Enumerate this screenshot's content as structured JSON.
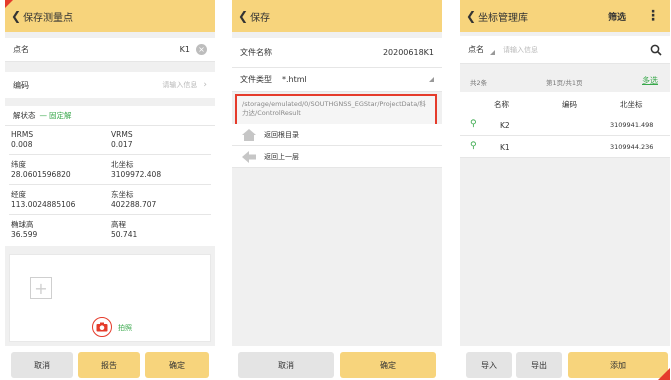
{
  "screen1": {
    "title": "保存测量点",
    "point_name_label": "点名",
    "point_name_value": "K1",
    "code_label": "编码",
    "code_placeholder": "请输入信息",
    "status_label": "解状态",
    "status_dash": "—",
    "status_value": "固定解",
    "hrms_label": "HRMS",
    "hrms_value": "0.008",
    "vrms_label": "VRMS",
    "vrms_value": "0.017",
    "lat_label": "纬度",
    "lat_value": "28.0601596820",
    "north_label": "北坐标",
    "north_value": "3109972.408",
    "lon_label": "经度",
    "lon_value": "113.0024885106",
    "east_label": "东坐标",
    "east_value": "402288.707",
    "ellh_label": "椭球高",
    "ellh_value": "36.599",
    "elev_label": "高程",
    "elev_value": "50.741",
    "photo_label": "拍照",
    "cancel": "取消",
    "report": "报告",
    "confirm": "确定"
  },
  "screen2": {
    "title": "保存",
    "filename_label": "文件名称",
    "filename_value": "20200618K1",
    "filetype_label": "文件类型",
    "filetype_value": "*.html",
    "path": "/storage/emulated/0/SOUTHGNSS_EGStar/ProjectData/科力达/ControlResult",
    "nav_root": "返回根目录",
    "nav_up": "返回上一层",
    "cancel": "取消",
    "confirm": "确定"
  },
  "screen3": {
    "title": "坐标管理库",
    "filter": "筛选",
    "search_field": "点名",
    "search_placeholder": "请输入信息",
    "total": "共2条",
    "page_info": "第1页/共1页",
    "multi_select": "多选",
    "columns": [
      "名称",
      "编码",
      "北坐标"
    ],
    "rows": [
      {
        "name": "K2",
        "code": "",
        "north": "3109941.498"
      },
      {
        "name": "K1",
        "code": "",
        "north": "3109944.236"
      }
    ],
    "import": "导入",
    "export": "导出",
    "add": "添加"
  },
  "colors": {
    "header": "#f7d47c",
    "accent_red": "#e53b2b",
    "green": "#38a84b",
    "muted": "#b8b8b8"
  },
  "icons": [
    "chevron-left-icon",
    "camera-icon",
    "home-icon",
    "back-arrow-icon",
    "search-icon",
    "more-vertical-icon",
    "pin-icon",
    "clear-icon",
    "chevron-right-icon",
    "plus-icon"
  ]
}
